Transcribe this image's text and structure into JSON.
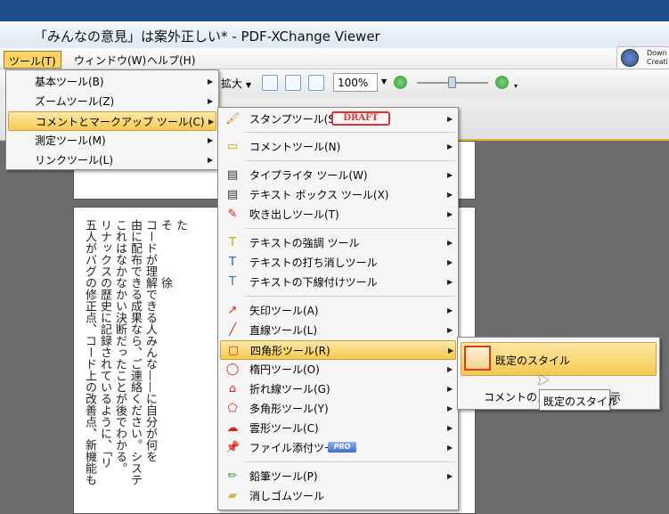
{
  "window": {
    "title": "「みんなの意見」は案外正しい* - PDF-XChange Viewer",
    "download_label": "Down\nCreati"
  },
  "menubar": {
    "items": [
      "ツール(T)",
      "ウィンドウ(W)",
      "ヘルプ(H)"
    ]
  },
  "toolbar": {
    "zoom_label": "拡大",
    "zoom_value": "100%",
    "zoom_slider_fraction": 0.5
  },
  "tools_menu": {
    "items": [
      "基本ツール(B)",
      "ズームツール(Z)",
      "コメントとマークアップ ツール(C)",
      "測定ツール(M)",
      "リンクツール(L)"
    ],
    "highlighted_index": 2
  },
  "comment_menu": {
    "draft_stamp": "DRAFT",
    "pro_badge": "PRO",
    "items": [
      {
        "label": "スタンプツール(S)",
        "icon": "stamp-icon",
        "submenu": true
      },
      {
        "label": "コメントツール(N)",
        "icon": "note-icon",
        "submenu": true
      },
      {
        "label": "タイプライタ ツール(W)",
        "icon": "typewriter-icon",
        "submenu": true
      },
      {
        "label": "テキスト ボックス ツール(X)",
        "icon": "textbox-icon",
        "submenu": true
      },
      {
        "label": "吹き出しツール(T)",
        "icon": "callout-icon",
        "submenu": true
      },
      {
        "label": "テキストの強調 ツール",
        "icon": "highlight-text-icon",
        "submenu": true
      },
      {
        "label": "テキストの打ち消しツール",
        "icon": "strikeout-icon",
        "submenu": true
      },
      {
        "label": "テキストの下線付けツール",
        "icon": "underline-icon",
        "submenu": true
      },
      {
        "label": "矢印ツール(A)",
        "icon": "arrow-tool-icon",
        "submenu": true
      },
      {
        "label": "直線ツール(L)",
        "icon": "line-tool-icon",
        "submenu": true
      },
      {
        "label": "四角形ツール(R)",
        "icon": "rectangle-tool-icon",
        "submenu": true
      },
      {
        "label": "楕円ツール(O)",
        "icon": "ellipse-tool-icon",
        "submenu": true
      },
      {
        "label": "折れ線ツール(G)",
        "icon": "polyline-tool-icon",
        "submenu": true
      },
      {
        "label": "多角形ツール(Y)",
        "icon": "polygon-tool-icon",
        "submenu": true
      },
      {
        "label": "雲形ツール(C)",
        "icon": "cloud-tool-icon",
        "submenu": true
      },
      {
        "label": "ファイル添付ツール",
        "icon": "attachment-pin-icon",
        "submenu": true
      },
      {
        "label": "鉛筆ツール(P)",
        "icon": "pencil-icon",
        "submenu": true
      },
      {
        "label": "消しゴムツール",
        "icon": "eraser-icon",
        "submenu": false
      }
    ],
    "highlighted_index": 10
  },
  "rect_submenu": {
    "items": [
      "既定のスタイル",
      "コメントのスタ",
      "示"
    ]
  },
  "tooltip": "既定のスタイル",
  "document": {
    "vertical_lines": [
      "た",
      "そ　　　　徐",
      "コードが理解できる人みんな——に自分が何を",
      "由に配布できる成果なら、ご連絡ください。システ",
      "これはなかなかい決断だったことが後でわかる。",
      "リナックスの歴史に記録されているように、「リ",
      "五人がバグの修正点、コード上の改善点、新機能も"
    ]
  },
  "colors": {
    "titlebar_top": "#1f4e8c",
    "highlight": "#f6c94e",
    "draft_red": "#d33333"
  }
}
